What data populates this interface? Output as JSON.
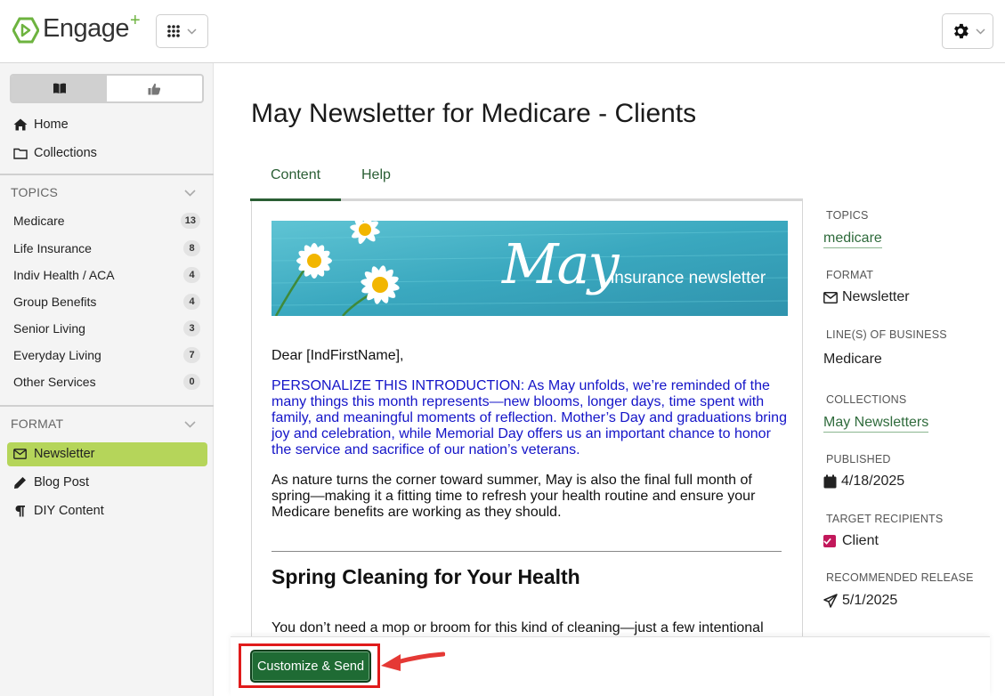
{
  "header": {
    "logo_text": "Engage",
    "logo_plus": "+",
    "apps_icon": "grid-icon",
    "settings_icon": "gear-icon"
  },
  "sidebar": {
    "view_toggle": [
      "book-icon",
      "thumbs-up-icon"
    ],
    "nav": [
      {
        "label": "Home",
        "icon": "home-icon"
      },
      {
        "label": "Collections",
        "icon": "folder-icon"
      }
    ],
    "topics_title": "TOPICS",
    "topics": [
      {
        "label": "Medicare",
        "count": "13"
      },
      {
        "label": "Life Insurance",
        "count": "8"
      },
      {
        "label": "Indiv Health / ACA",
        "count": "4"
      },
      {
        "label": "Group Benefits",
        "count": "4"
      },
      {
        "label": "Senior Living",
        "count": "3"
      },
      {
        "label": "Everyday Living",
        "count": "7"
      },
      {
        "label": "Other Services",
        "count": "0"
      }
    ],
    "format_title": "FORMAT",
    "formats": [
      {
        "label": "Newsletter",
        "icon": "envelope-icon",
        "active": true
      },
      {
        "label": "Blog Post",
        "icon": "pencil-icon",
        "active": false
      },
      {
        "label": "DIY Content",
        "icon": "pilcrow-icon",
        "active": false
      }
    ]
  },
  "main": {
    "title": "May Newsletter for Medicare - Clients",
    "tabs": [
      {
        "label": "Content",
        "active": true
      },
      {
        "label": "Help",
        "active": false
      }
    ],
    "banner": {
      "title": "May",
      "subtitle": "insurance newsletter"
    },
    "greeting": "Dear [IndFirstName],",
    "intro_personalize": "PERSONALIZE THIS INTRODUCTION: As May unfolds, we’re reminded of the many things this month represents—new blooms, longer days, time spent with family, and meaningful moments of reflection. Mother’s Day and graduations bring joy and celebration, while Memorial Day offers us an important chance to honor the service and sacrifice of our nation’s veterans.",
    "paragraph_1": "As nature turns the corner toward summer, May is also the final full month of spring—making it a fitting time to refresh your health routine and ensure your Medicare benefits are working as they should.",
    "heading_1": "Spring Cleaning for Your Health",
    "paragraph_2": "You don’t need a mop or broom for this kind of cleaning—just a few intentional"
  },
  "meta": {
    "topics_label": "TOPICS",
    "topics_value": "medicare",
    "format_label": "FORMAT",
    "format_value": "Newsletter",
    "lob_label": "LINE(S) OF BUSINESS",
    "lob_value": "Medicare",
    "collections_label": "COLLECTIONS",
    "collections_value": "May Newsletters",
    "published_label": "PUBLISHED",
    "published_value": "4/18/2025",
    "recipients_label": "TARGET RECIPIENTS",
    "recipients_value": "Client",
    "release_label": "RECOMMENDED RELEASE",
    "release_value": "5/1/2025"
  },
  "footer": {
    "send_label": "Customize & Send"
  },
  "colors": {
    "brand_green": "#1f6b34",
    "link_green": "#2f6b3c",
    "active_format": "#b5d55a",
    "personalize_blue": "#1414c8",
    "highlight_red": "#e01b1b",
    "checkbox_pink": "#c2185b"
  }
}
